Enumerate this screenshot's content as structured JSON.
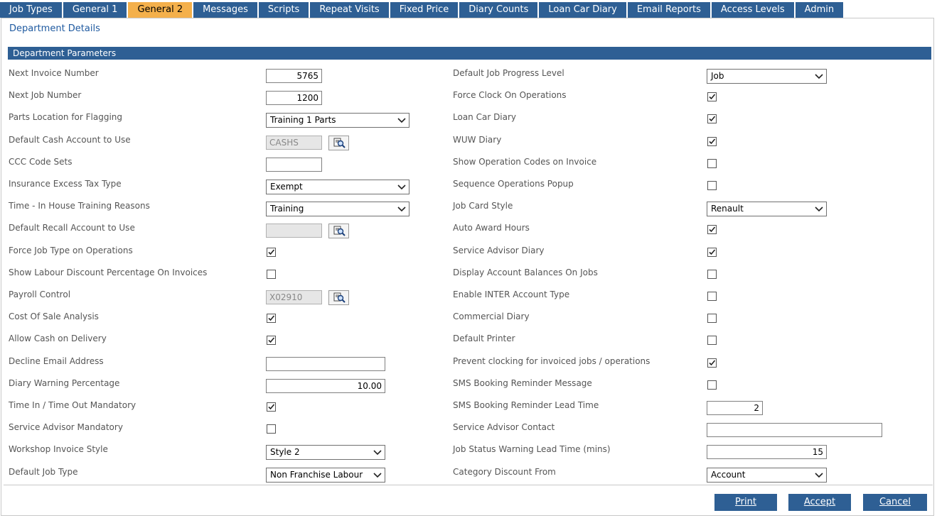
{
  "tabs": [
    {
      "label": "Job Types",
      "active": false
    },
    {
      "label": "General 1",
      "active": false
    },
    {
      "label": "General 2",
      "active": true
    },
    {
      "label": "Messages",
      "active": false
    },
    {
      "label": "Scripts",
      "active": false
    },
    {
      "label": "Repeat Visits",
      "active": false
    },
    {
      "label": "Fixed Price",
      "active": false
    },
    {
      "label": "Diary Counts",
      "active": false
    },
    {
      "label": "Loan Car Diary",
      "active": false
    },
    {
      "label": "Email Reports",
      "active": false
    },
    {
      "label": "Access Levels",
      "active": false
    },
    {
      "label": "Admin",
      "active": false
    }
  ],
  "page_title": "Department Details",
  "section_title": "Department Parameters",
  "left_fields": [
    {
      "label": "Next Invoice Number",
      "type": "number",
      "value": "5765",
      "width": 79
    },
    {
      "label": "Next Job Number",
      "type": "number",
      "value": "1200",
      "width": 79
    },
    {
      "label": "Parts Location for Flagging",
      "type": "select",
      "value": "Training 1 Parts",
      "width": 202
    },
    {
      "label": "Default Cash Account to Use",
      "type": "lookup",
      "value": "CASHS",
      "width": 79
    },
    {
      "label": "CCC Code Sets",
      "type": "text",
      "value": "",
      "width": 79
    },
    {
      "label": "Insurance Excess Tax Type",
      "type": "select",
      "value": "Exempt",
      "width": 202
    },
    {
      "label": "Time - In House Training Reasons",
      "type": "select",
      "value": "Training",
      "width": 202
    },
    {
      "label": "Default Recall Account to Use",
      "type": "lookup",
      "value": "",
      "width": 79
    },
    {
      "label": "Force Job Type on Operations",
      "type": "checkbox",
      "checked": true
    },
    {
      "label": "Show Labour Discount Percentage On Invoices",
      "type": "checkbox",
      "checked": false
    },
    {
      "label": "Payroll Control",
      "type": "lookup",
      "value": "X02910",
      "width": 79
    },
    {
      "label": "Cost Of Sale Analysis",
      "type": "checkbox",
      "checked": true
    },
    {
      "label": "Allow Cash on Delivery",
      "type": "checkbox",
      "checked": true
    },
    {
      "label": "Decline Email Address",
      "type": "text",
      "value": "",
      "width": 168
    },
    {
      "label": "Diary Warning Percentage",
      "type": "number",
      "value": "10.00",
      "width": 168
    },
    {
      "label": "Time In / Time Out Mandatory",
      "type": "checkbox",
      "checked": true
    },
    {
      "label": "Service Advisor Mandatory",
      "type": "checkbox",
      "checked": false
    },
    {
      "label": "Workshop Invoice Style",
      "type": "select",
      "value": "Style 2",
      "width": 168
    },
    {
      "label": "Default Job Type",
      "type": "select",
      "value": "Non Franchise Labour",
      "width": 168
    }
  ],
  "right_fields": [
    {
      "label": "Default Job Progress Level",
      "type": "select",
      "value": "Job",
      "width": 169
    },
    {
      "label": "Force Clock On Operations",
      "type": "checkbox",
      "checked": true
    },
    {
      "label": "Loan Car Diary",
      "type": "checkbox",
      "checked": true
    },
    {
      "label": "WUW Diary",
      "type": "checkbox",
      "checked": true
    },
    {
      "label": "Show Operation Codes on Invoice",
      "type": "checkbox",
      "checked": false
    },
    {
      "label": "Sequence Operations Popup",
      "type": "checkbox",
      "checked": false
    },
    {
      "label": "Job Card Style",
      "type": "select",
      "value": "Renault",
      "width": 169
    },
    {
      "label": "Auto Award Hours",
      "type": "checkbox",
      "checked": true
    },
    {
      "label": "Service Advisor Diary",
      "type": "checkbox",
      "checked": true
    },
    {
      "label": "Display Account Balances On Jobs",
      "type": "checkbox",
      "checked": false
    },
    {
      "label": "Enable INTER Account Type",
      "type": "checkbox",
      "checked": false
    },
    {
      "label": "Commercial Diary",
      "type": "checkbox",
      "checked": false
    },
    {
      "label": "Default Printer",
      "type": "checkbox",
      "checked": false
    },
    {
      "label": "Prevent clocking for invoiced jobs / operations",
      "type": "checkbox",
      "checked": true
    },
    {
      "label": "SMS Booking Reminder Message",
      "type": "checkbox",
      "checked": false
    },
    {
      "label": "SMS Booking Reminder Lead Time",
      "type": "number",
      "value": "2",
      "width": 79
    },
    {
      "label": "Service Advisor Contact",
      "type": "text",
      "value": "",
      "width": 247
    },
    {
      "label": "Job Status Warning Lead Time (mins)",
      "type": "number",
      "value": "15",
      "width": 169
    },
    {
      "label": "Category Discount From",
      "type": "select",
      "value": "Account",
      "width": 169
    }
  ],
  "buttons": [
    {
      "label": "Print"
    },
    {
      "label": "Accept"
    },
    {
      "label": "Cancel"
    }
  ],
  "colors": {
    "tab_bg": "#2e5f94",
    "tab_active_bg": "#f4b04b",
    "title": "#1f5aa0"
  }
}
